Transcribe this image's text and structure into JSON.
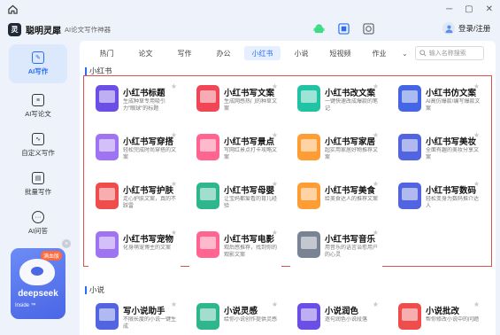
{
  "app": {
    "name": "聪明灵犀",
    "subtitle": "AI论文写作神器",
    "logo_text": "灵"
  },
  "window_controls": [
    "─",
    "▢",
    "✕"
  ],
  "top_icons": [
    {
      "name": "android-icon",
      "color": "#3ddc84"
    },
    {
      "name": "windows-icon",
      "color": "#2a6df4"
    },
    {
      "name": "mac-icon",
      "color": "#555555"
    }
  ],
  "user": {
    "label": "登录/注册"
  },
  "sidebar": {
    "items": [
      {
        "label": "AI写作",
        "icon": "pen-icon"
      },
      {
        "label": "AI写论文",
        "icon": "paper-icon"
      },
      {
        "label": "自定义写作",
        "icon": "chart-icon"
      },
      {
        "label": "批量写作",
        "icon": "docs-icon"
      },
      {
        "label": "AI问答",
        "icon": "chat-icon"
      }
    ]
  },
  "promo": {
    "badge": "满血版",
    "brand": "deepseek",
    "tagline": "Inside ™",
    "close": "×"
  },
  "tabs": [
    "热门",
    "论文",
    "写作",
    "办公",
    "小红书",
    "小说",
    "短视频",
    "作业"
  ],
  "active_tab": "小红书",
  "search": {
    "placeholder": "输入名称搜索"
  },
  "sections": {
    "xiaohongshu": "小红书",
    "novel": "小说"
  },
  "xhs_cards": [
    {
      "title": "小红书标题",
      "desc": "生成种草专用吸引力\"眼球\"的标题",
      "color": "#6a4ee6"
    },
    {
      "title": "小红书写文案",
      "desc": "生成网感热门的种草文案",
      "color": "#f04656"
    },
    {
      "title": "小红书改文案",
      "desc": "一键快速改成爆款的笔记",
      "color": "#22c3a4"
    },
    {
      "title": "小红书仿文案",
      "desc": "AI高仿爆款/编写爆款文案",
      "color": "#4466e5"
    },
    {
      "title": "小红书写穿搭",
      "desc": "轻松完成时尚穿搭的文案",
      "color": "#9f74f2"
    },
    {
      "title": "小红书写景点",
      "desc": "写网红景点打卡攻略文案",
      "color": "#ff6590"
    },
    {
      "title": "小红书写家居",
      "desc": "超实用家居好物推荐文案",
      "color": "#ff9d35"
    },
    {
      "title": "小红书写美妆",
      "desc": "全面有趣的美妆分享文案",
      "color": "#5364e1"
    },
    {
      "title": "小红书写护肤",
      "desc": "走心护肤文案，真的不踩雷",
      "color": "#ef4c4c"
    },
    {
      "title": "小红书写母婴",
      "desc": "让宝妈都爱看的育儿经验",
      "color": "#2fb68c"
    },
    {
      "title": "小红书写美食",
      "desc": "给美食达人的推荐文案",
      "color": "#ff9d35"
    },
    {
      "title": "小红书写数码",
      "desc": "轻松变身为数码推介达人",
      "color": "#5364e1"
    },
    {
      "title": "小红书写宠物",
      "desc": "化身萌宠博主的文案",
      "color": "#9f74f2"
    },
    {
      "title": "小红书写电影",
      "desc": "观后感推荐，找到你的观影文案",
      "color": "#ff6590"
    },
    {
      "title": "小红书写音乐",
      "desc": "用音乐的语言治愈用户的心灵",
      "color": "#7a8394"
    }
  ],
  "novel_cards": [
    {
      "title": "写小说助手",
      "desc": "不限长度的小说一键生成",
      "color": "#5364e1"
    },
    {
      "title": "小说灵感",
      "desc": "给你小说创作提供灵感",
      "color": "#2fb68c"
    },
    {
      "title": "小说润色",
      "desc": "逐句润色小说段落",
      "color": "#6a4ee6"
    },
    {
      "title": "小说批改",
      "desc": "帮你修改小说中的问题",
      "color": "#ef4c4c"
    }
  ],
  "star": "★"
}
